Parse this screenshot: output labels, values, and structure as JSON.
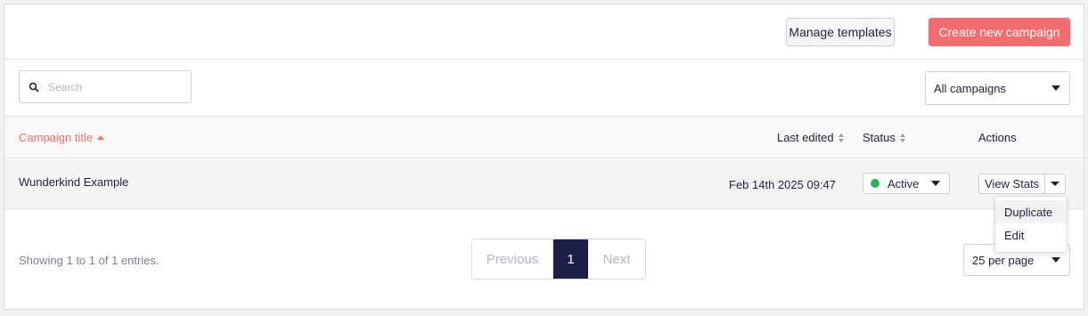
{
  "toolbar": {
    "manage_templates_label": "Manage templates",
    "create_campaign_label": "Create new campaign"
  },
  "filters": {
    "search_placeholder": "Search",
    "campaign_filter_value": "All campaigns"
  },
  "table": {
    "columns": {
      "title": "Campaign title",
      "last_edited": "Last edited",
      "status": "Status",
      "actions": "Actions"
    },
    "rows": [
      {
        "title": "Wunderkind Example",
        "last_edited": "Feb 14th 2025 09:47",
        "status": "Active",
        "action_label": "View Stats"
      }
    ],
    "action_menu": [
      "Duplicate",
      "Edit"
    ]
  },
  "footer": {
    "showing_text": "Showing 1 to 1 of 1 entries.",
    "pagination": {
      "previous_label": "Previous",
      "current_page": "1",
      "next_label": "Next"
    },
    "per_page_value": "25 per page"
  },
  "colors": {
    "accent": "#f26d6d",
    "active_status": "#2fb35a",
    "current_page_bg": "#1d1f4a"
  }
}
